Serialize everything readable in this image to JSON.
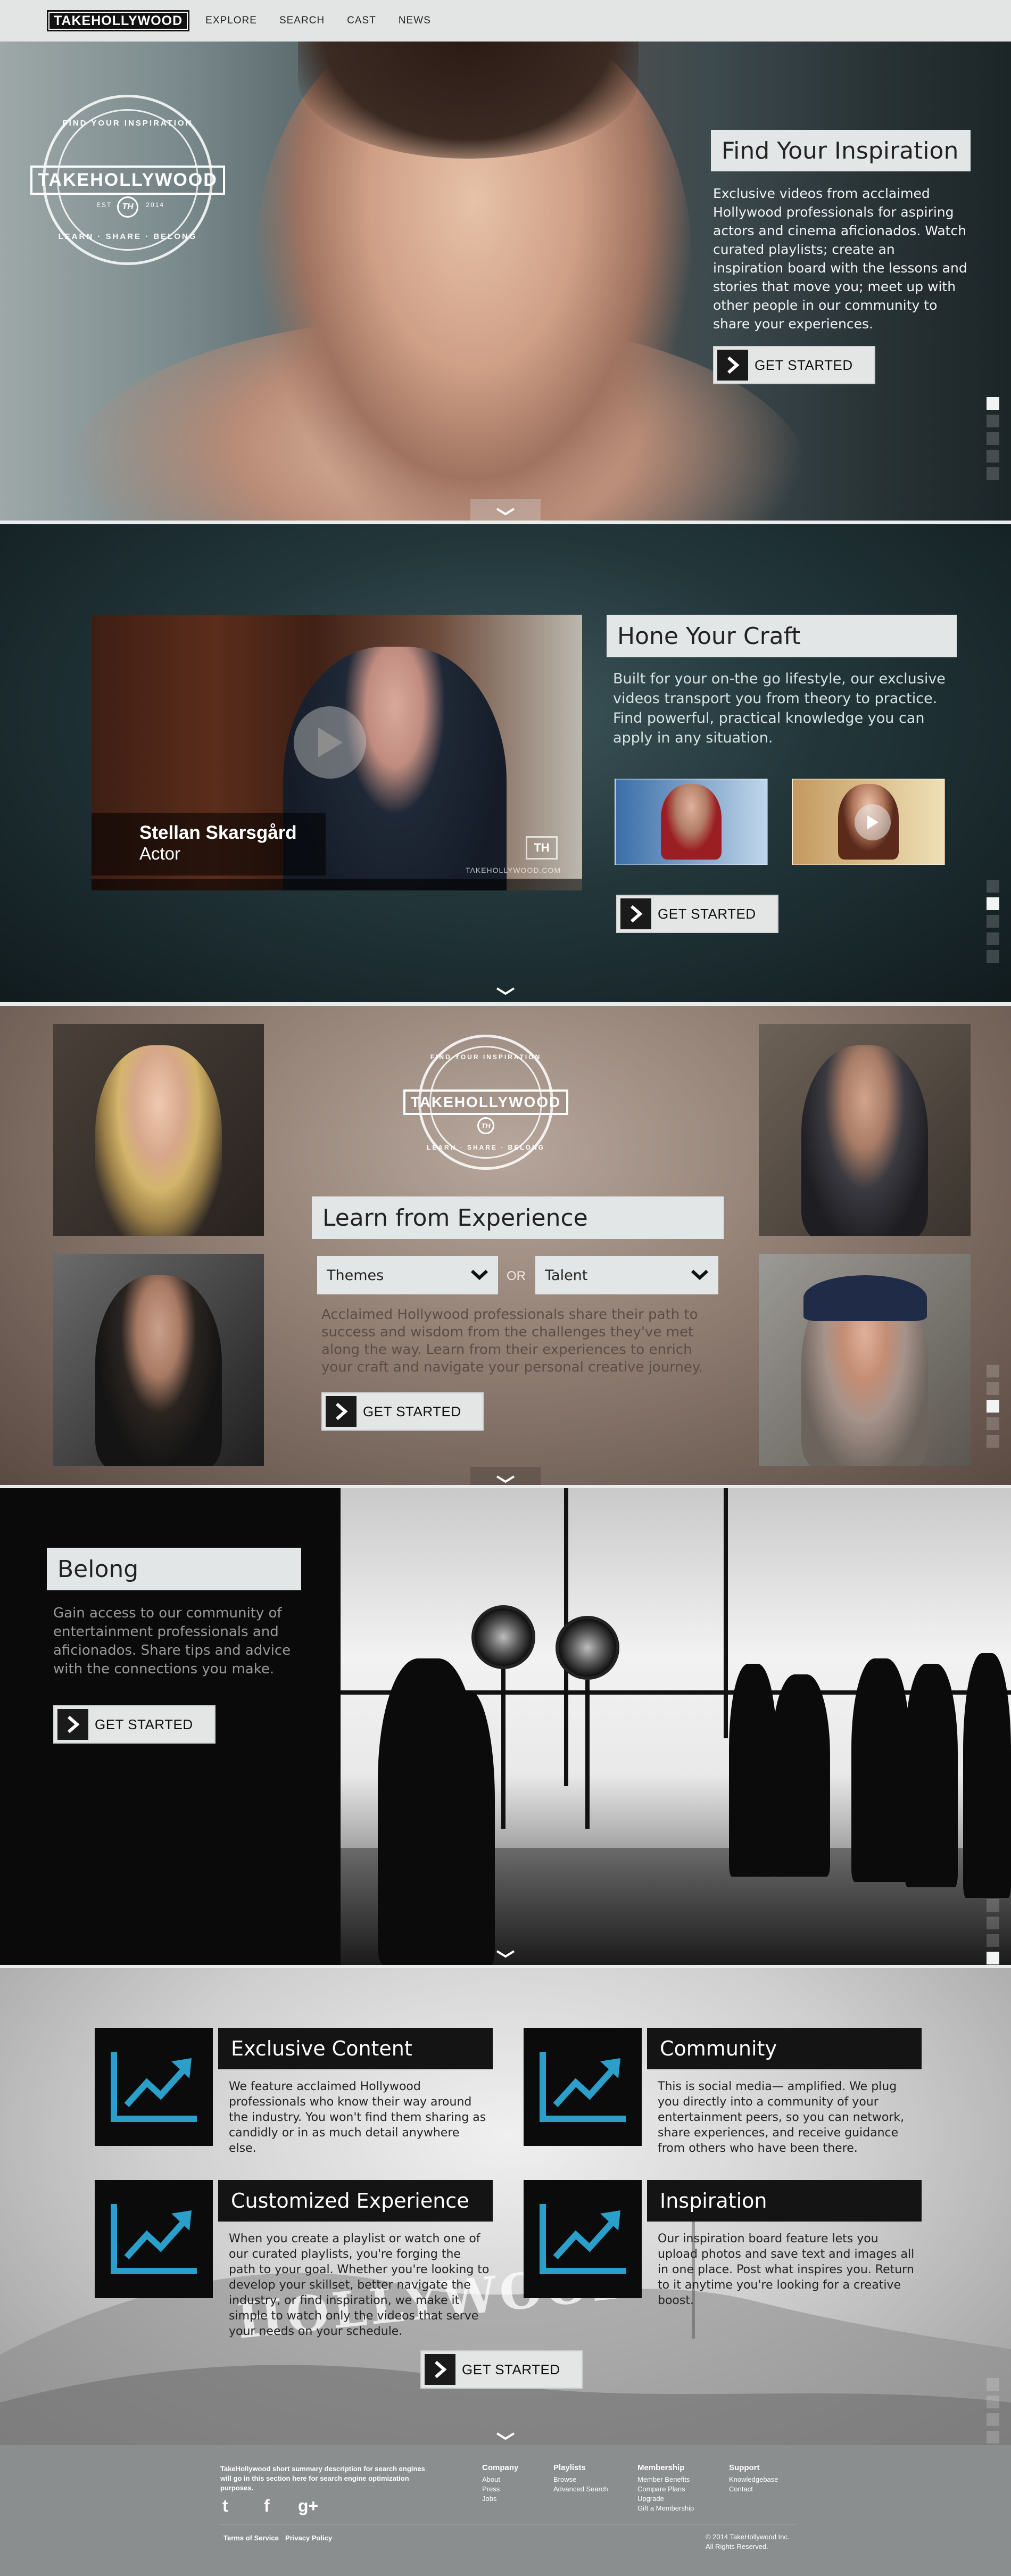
{
  "nav": {
    "logo": "TAKEHOLLYWOOD",
    "links": [
      "EXPLORE",
      "SEARCH",
      "CAST",
      "NEWS"
    ]
  },
  "crest": {
    "name": "TAKEHOLLYWOOD",
    "top_ring": "FIND YOUR INSPIRATION",
    "bottom_ring": "LEARN · SHARE · BELONG",
    "est_left": "EST",
    "est_right": "2014",
    "monogram": "TH"
  },
  "hero": {
    "heading": "Find Your Inspiration",
    "body": "Exclusive videos from acclaimed Hollywood professionals for aspiring actors and cinema aficionados. Watch curated playlists; create an inspiration board with the lessons and stories that move you; meet up with other people in our community to share your experiences.",
    "cta": "GET STARTED"
  },
  "craft": {
    "heading": "Hone Your Craft",
    "body": "Built for your on-the go lifestyle, our exclusive videos transport you from theory to practice. Find powerful, practical knowledge you can apply in any situation.",
    "cta": "GET STARTED",
    "video_name": "Stellan Skarsgård",
    "video_role": "Actor",
    "video_watermark": "TAKEHOLLYWOOD.COM",
    "video_logo": "TH"
  },
  "learn": {
    "heading": "Learn from Experience",
    "select_themes": "Themes",
    "or": "OR",
    "select_talent": "Talent",
    "body": "Acclaimed Hollywood professionals share their path to success and wisdom from the challenges they've met along the way. Learn from their experiences to enrich your craft and navigate your personal creative journey.",
    "cta": "GET STARTED"
  },
  "belong": {
    "heading": "Belong",
    "body": "Gain access to our community of entertainment professionals and aficionados. Share tips and advice with the connections you make.",
    "cta": "GET STARTED"
  },
  "features": {
    "items": [
      {
        "title": "Exclusive Content",
        "text": "We feature acclaimed Hollywood professionals who know their way around the industry. You won't find them sharing as candidly or in as much detail anywhere else."
      },
      {
        "title": "Community",
        "text": "This is social media— amplified. We plug you directly into a community of your entertainment peers, so you can network, share experiences, and receive guidance from others who have been there."
      },
      {
        "title": "Customized Experience",
        "text": "When you create a playlist or watch one of our curated playlists, you're forging the path to your goal. Whether you're looking to develop your skillset, better navigate the industry, or find inspiration, we make it simple to watch only the videos that serve your needs on your schedule."
      },
      {
        "title": "Inspiration",
        "text": "Our inspiration board feature lets you upload photos and save text and images all in one place. Post what inspires you. Return to it anytime you're looking for a creative boost."
      }
    ],
    "sign": "HOLLYWOOD",
    "cta": "GET STARTED",
    "accent": "#2a9fc9"
  },
  "footer": {
    "description": "TakeHollywood short summary description for search engines will go in this section here for search engine optimization purposes.",
    "social": [
      "t",
      "f",
      "g+"
    ],
    "terms": "Terms of Service",
    "privacy": "Privacy Policy",
    "columns": [
      {
        "title": "Company",
        "links": [
          "About",
          "Press",
          "Jobs"
        ]
      },
      {
        "title": "Playlists",
        "links": [
          "Browse",
          "Advanced Search"
        ]
      },
      {
        "title": "Membership",
        "links": [
          "Member Benefits",
          "Compare Plans",
          "Upgrade",
          "Gift a Membership"
        ]
      },
      {
        "title": "Support",
        "links": [
          "Knowledgebase",
          "Contact"
        ]
      }
    ],
    "copyright": "© 2014 TakeHollywood Inc.",
    "rights": "All Rights Reserved."
  }
}
